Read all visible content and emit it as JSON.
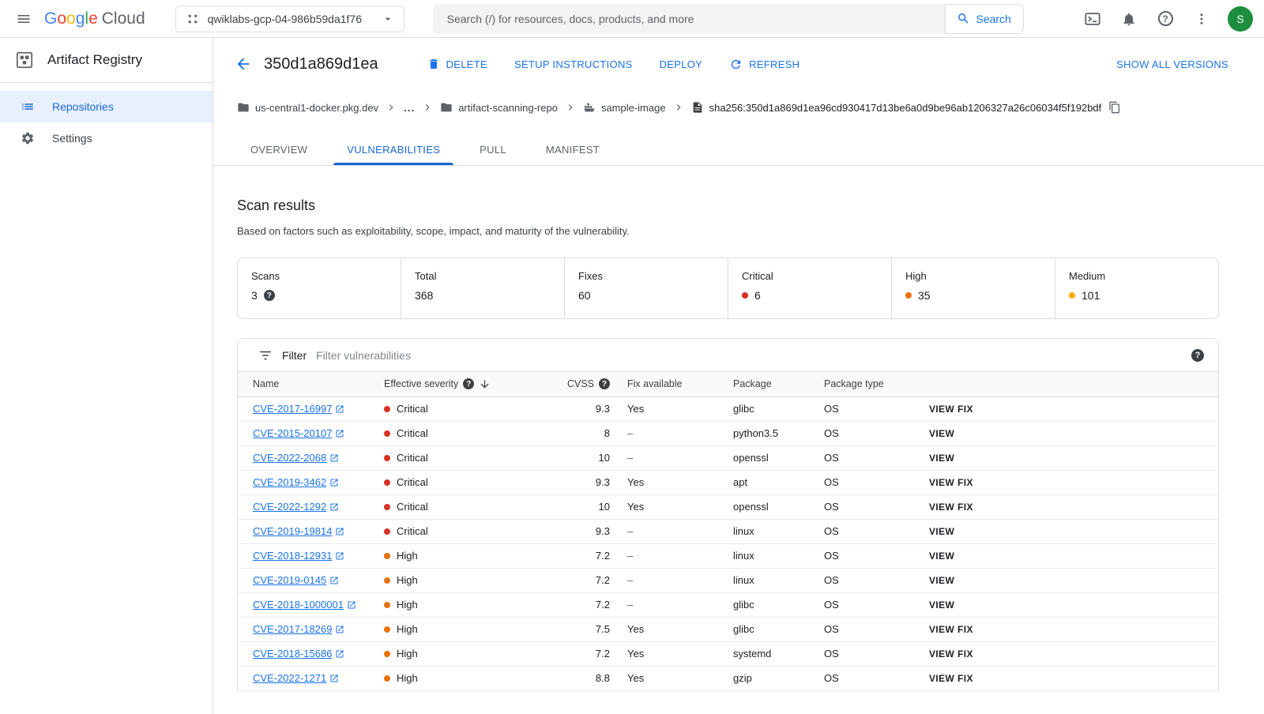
{
  "topbar": {
    "logo_google": "Google",
    "logo_cloud": "Cloud",
    "logo_colors": [
      "#4285F4",
      "#EA4335",
      "#FBBC05",
      "#4285F4",
      "#34A853",
      "#EA4335"
    ],
    "project_name": "qwiklabs-gcp-04-986b59da1f76",
    "search_placeholder": "Search (/) for resources, docs, products, and more",
    "search_button_label": "Search",
    "avatar_letter": "S"
  },
  "sidebar": {
    "product_title": "Artifact Registry",
    "items": [
      {
        "label": "Repositories",
        "active": true
      },
      {
        "label": "Settings",
        "active": false
      }
    ]
  },
  "page_header": {
    "title": "350d1a869d1ea",
    "delete_label": "DELETE",
    "setup_label": "SETUP INSTRUCTIONS",
    "deploy_label": "DEPLOY",
    "refresh_label": "REFRESH",
    "show_all_versions_label": "SHOW ALL VERSIONS"
  },
  "breadcrumb": {
    "registry": "us-central1-docker.pkg.dev",
    "collapsed": "...",
    "repository": "artifact-scanning-repo",
    "image": "sample-image",
    "digest": "sha256:350d1a869d1ea96cd930417d13be6a0d9be96ab1206327a26c06034f5f192bdf"
  },
  "tabs": [
    {
      "label": "OVERVIEW",
      "active": false
    },
    {
      "label": "VULNERABILITIES",
      "active": true
    },
    {
      "label": "PULL",
      "active": false
    },
    {
      "label": "MANIFEST",
      "active": false
    }
  ],
  "scan": {
    "title": "Scan results",
    "subtitle": "Based on factors such as exploitability, scope, impact, and maturity of the vulnerability.",
    "stats": [
      {
        "label": "Scans",
        "value": "3",
        "help": true
      },
      {
        "label": "Total",
        "value": "368"
      },
      {
        "label": "Fixes",
        "value": "60"
      },
      {
        "label": "Critical",
        "value": "6",
        "dot": "#d93025"
      },
      {
        "label": "High",
        "value": "35",
        "dot": "#e8710a"
      },
      {
        "label": "Medium",
        "value": "101",
        "dot": "#f9ab00"
      }
    ]
  },
  "filter": {
    "label": "Filter",
    "placeholder": "Filter vulnerabilities"
  },
  "table": {
    "columns": [
      "Name",
      "Effective severity",
      "CVSS",
      "Fix available",
      "Package",
      "Package type"
    ],
    "severity_colors": {
      "Critical": "#d93025",
      "High": "#e8710a",
      "Medium": "#f9ab00"
    },
    "rows": [
      {
        "name": "CVE-2017-16997",
        "severity": "Critical",
        "cvss": "9.3",
        "fix": "Yes",
        "package": "glibc",
        "type": "OS",
        "action": "VIEW FIX"
      },
      {
        "name": "CVE-2015-20107",
        "severity": "Critical",
        "cvss": "8",
        "fix": "–",
        "package": "python3.5",
        "type": "OS",
        "action": "VIEW"
      },
      {
        "name": "CVE-2022-2068",
        "severity": "Critical",
        "cvss": "10",
        "fix": "–",
        "package": "openssl",
        "type": "OS",
        "action": "VIEW"
      },
      {
        "name": "CVE-2019-3462",
        "severity": "Critical",
        "cvss": "9.3",
        "fix": "Yes",
        "package": "apt",
        "type": "OS",
        "action": "VIEW FIX"
      },
      {
        "name": "CVE-2022-1292",
        "severity": "Critical",
        "cvss": "10",
        "fix": "Yes",
        "package": "openssl",
        "type": "OS",
        "action": "VIEW FIX"
      },
      {
        "name": "CVE-2019-19814",
        "severity": "Critical",
        "cvss": "9.3",
        "fix": "–",
        "package": "linux",
        "type": "OS",
        "action": "VIEW"
      },
      {
        "name": "CVE-2018-12931",
        "severity": "High",
        "cvss": "7.2",
        "fix": "–",
        "package": "linux",
        "type": "OS",
        "action": "VIEW"
      },
      {
        "name": "CVE-2019-0145",
        "severity": "High",
        "cvss": "7.2",
        "fix": "–",
        "package": "linux",
        "type": "OS",
        "action": "VIEW"
      },
      {
        "name": "CVE-2018-1000001",
        "severity": "High",
        "cvss": "7.2",
        "fix": "–",
        "package": "glibc",
        "type": "OS",
        "action": "VIEW"
      },
      {
        "name": "CVE-2017-18269",
        "severity": "High",
        "cvss": "7.5",
        "fix": "Yes",
        "package": "glibc",
        "type": "OS",
        "action": "VIEW FIX"
      },
      {
        "name": "CVE-2018-15686",
        "severity": "High",
        "cvss": "7.2",
        "fix": "Yes",
        "package": "systemd",
        "type": "OS",
        "action": "VIEW FIX"
      },
      {
        "name": "CVE-2022-1271",
        "severity": "High",
        "cvss": "8.8",
        "fix": "Yes",
        "package": "gzip",
        "type": "OS",
        "action": "VIEW FIX"
      }
    ]
  }
}
